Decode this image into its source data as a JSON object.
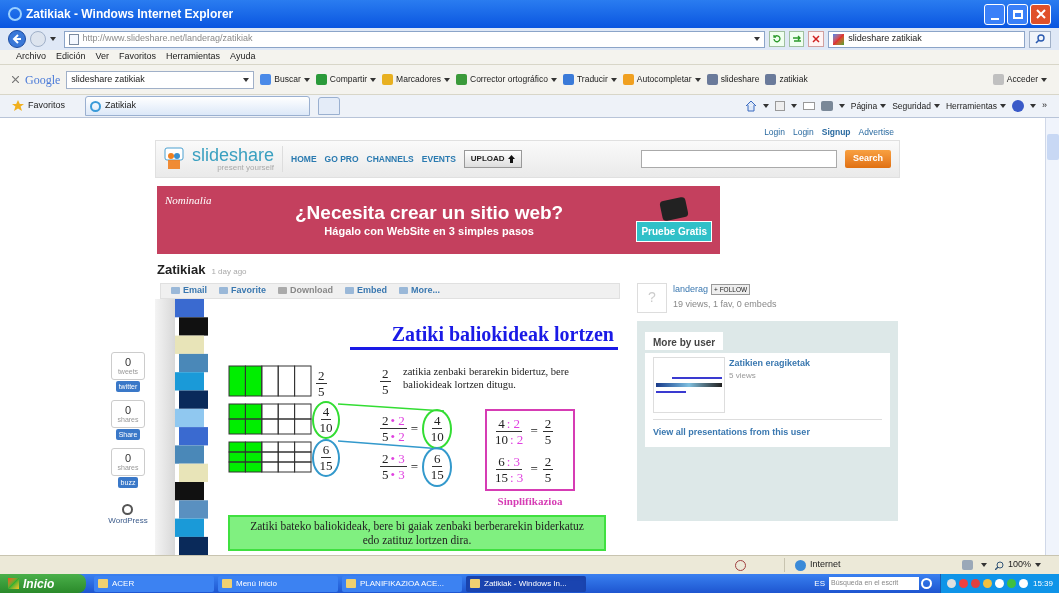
{
  "window": {
    "title": "Zatikiak - Windows Internet Explorer"
  },
  "address_bar": {
    "url": "http://www.slideshare.net/landerag/zatikiak",
    "search": "slideshare zatikiak"
  },
  "menu": [
    "Archivo",
    "Edición",
    "Ver",
    "Favoritos",
    "Herramientas",
    "Ayuda"
  ],
  "google_toolbar": {
    "logo": "Google",
    "query": "slideshare zatikiak",
    "items": [
      {
        "label": "Buscar",
        "menu": true
      },
      {
        "label": "Compartir",
        "menu": true
      },
      {
        "label": "Marcadores",
        "menu": true
      },
      {
        "label": "Corrector ortográfico",
        "menu": true
      },
      {
        "label": "Traducir",
        "menu": true
      },
      {
        "label": "Autocompletar",
        "menu": true
      },
      {
        "label": "slideshare",
        "menu": false
      },
      {
        "label": "zatikiak",
        "menu": false
      },
      {
        "label": "Acceder",
        "menu": true
      }
    ]
  },
  "favorites_bar": {
    "favorites": "Favoritos",
    "tabs": [
      {
        "label": "Zatikiak",
        "selected": true
      }
    ],
    "commands": [
      "Página",
      "Seguridad",
      "Herramientas"
    ],
    "overflow": "»"
  },
  "page": {
    "top_links": [
      {
        "label": "Login",
        "bold": false
      },
      {
        "label": "Login",
        "bold": false
      },
      {
        "label": "Signup",
        "bold": true
      },
      {
        "label": "Advertise",
        "bold": false
      }
    ],
    "logo": "slideshare",
    "tagline": "present yourself",
    "nav": [
      "HOME",
      "GO PRO",
      "CHANNELS",
      "EVENTS"
    ],
    "upload": "UPLOAD",
    "search_button": "Search",
    "ad": {
      "brand": "Nominalia",
      "headline": "¿Necesita crear un sitio web?",
      "subline": "Hágalo con WebSite en 3 simples pasos",
      "cta": "Pruebe Gratis"
    },
    "title": "Zatikiak",
    "age": "1 day ago",
    "actions": [
      {
        "label": "Email",
        "disabled": false
      },
      {
        "label": "Favorite",
        "disabled": false
      },
      {
        "label": "Download",
        "disabled": true
      },
      {
        "label": "Embed",
        "disabled": false
      },
      {
        "label": "More...",
        "disabled": false
      }
    ],
    "social": [
      {
        "count": "0",
        "label": "tweets",
        "button": "twitter"
      },
      {
        "count": "0",
        "label": "shares",
        "button": "Share"
      },
      {
        "count": "0",
        "label": "shares",
        "button": "buzz"
      }
    ],
    "wordpress": "WordPress",
    "slide": {
      "title": "Zatiki baliokideak lortzen",
      "equals": "=",
      "bars": [
        {
          "level": 0.4,
          "num": "2",
          "den": "5"
        },
        {
          "level": 0.4,
          "num": "4",
          "den": "10",
          "color": "#33dd33"
        },
        {
          "level": 0.4,
          "num": "6",
          "den": "15",
          "color": "#3399cc"
        }
      ],
      "intro": {
        "num": "2",
        "den": "5",
        "text": "zatikia zenbaki berarekin bidertuz, bere baliokideak lortzen ditugu."
      },
      "equations": [
        {
          "num": "2",
          "num_op": "• 2",
          "den": "5",
          "den_op": "• 2",
          "rnum": "4",
          "rden": "10",
          "color": "#33dd33"
        },
        {
          "num": "2",
          "num_op": "• 3",
          "den": "5",
          "den_op": "• 3",
          "rnum": "6",
          "rden": "15",
          "color": "#3399cc"
        }
      ],
      "simplification": [
        {
          "num": "4",
          "num_op": ": 2",
          "den": "10",
          "den_op": ": 2",
          "rnum": "2",
          "rden": "5"
        },
        {
          "num": "6",
          "num_op": ": 3",
          "den": "15",
          "den_op": ": 3",
          "rnum": "2",
          "rden": "5"
        }
      ],
      "simplification_label": "Sinplifikazioa",
      "note": "Zatiki bateko baliokideak, bere bi gaiak zenbaki berberarekin biderkatuz edo zatituz lortzen dira."
    },
    "user": {
      "avatar": "?",
      "name": "landerag",
      "follow": "+ FOLLOW",
      "stats": "19 views, 1 fav, 0 embeds"
    },
    "more_by_user": {
      "title": "More by user",
      "items": [
        {
          "title": "Zatikien eragiketak",
          "views": "5 views"
        }
      ],
      "link": "View all presentations from this user"
    }
  },
  "status_bar": {
    "zone": "Internet",
    "zoom": "100%"
  },
  "taskbar": {
    "start": "Inicio",
    "tasks": [
      {
        "label": "ACER",
        "selected": false
      },
      {
        "label": "Menú Inicio",
        "selected": false
      },
      {
        "label": "PLANIFIKAZIOA ACE...",
        "selected": false
      },
      {
        "label": "Zatikiak - Windows In...",
        "selected": true
      }
    ],
    "language": "ES",
    "search_placeholder": "Búsqueda en el escrit",
    "clock": "15:39"
  }
}
